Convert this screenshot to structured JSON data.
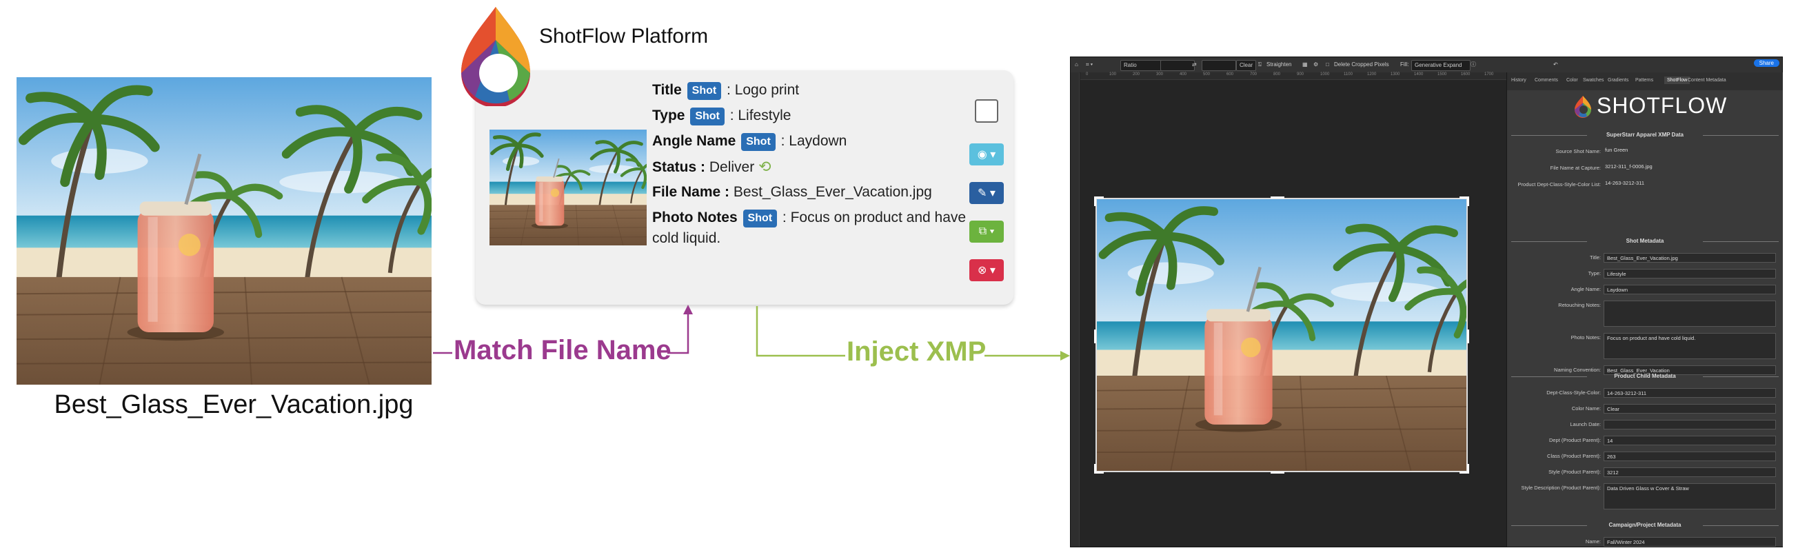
{
  "left_file_name": "Best_Glass_Ever_Vacation.jpg",
  "platform_title": "ShotFlow Platform",
  "shot_badge": "Shot",
  "card": {
    "title_label": "Title",
    "title_value": ": Logo print",
    "type_label": "Type",
    "type_value": ": Lifestyle",
    "angle_label": "Angle Name",
    "angle_value": ": Laydown",
    "status_label": "Status :",
    "status_value": "Deliver",
    "filename_label": "File Name :",
    "filename_value": "Best_Glass_Ever_Vacation.jpg",
    "notes_label": "Photo Notes",
    "notes_value": ": Focus on product and have cold liquid."
  },
  "arrows": {
    "match": "Match File Name",
    "inject": "Inject XMP"
  },
  "editor": {
    "toolbar": {
      "ratio": "Ratio",
      "clear": "Clear",
      "straighten": "Straighten",
      "delete_cropped": "Delete Cropped Pixels",
      "fill_label": "Fill:",
      "fill_value": "Generative Expand",
      "share": "Share"
    },
    "ruler_ticks": [
      "0",
      "100",
      "200",
      "300",
      "400",
      "500",
      "600",
      "700",
      "800",
      "900",
      "1000",
      "1100",
      "1200",
      "1300",
      "1400",
      "1500",
      "1600",
      "1700"
    ],
    "tabs": [
      "History",
      "Comments",
      "Color",
      "Swatches",
      "Gradients",
      "Patterns",
      "ShotFlow",
      "Content Metadata"
    ],
    "active_tab": "ShotFlow",
    "panel_logo": "SHOTFLOW",
    "sections": {
      "superstar": "SuperStarr Apparel XMP Data",
      "shot_meta": "Shot Metadata",
      "product_child": "Product Child Metadata",
      "campaign": "Campaign/Project Metadata"
    },
    "superstar_rows": [
      {
        "label": "Source Shot Name:",
        "value": "fun Green"
      },
      {
        "label": "File Name at Capture:",
        "value": "3212-311_f-0006.jpg"
      },
      {
        "label": "Product Dept-Class-Style-Color List:",
        "value": "14-263-3212-311"
      }
    ],
    "shot_rows": [
      {
        "label": "Title:",
        "value": "Best_Glass_Ever_Vacation.jpg"
      },
      {
        "label": "Type:",
        "value": "Lifestyle"
      },
      {
        "label": "Angle Name:",
        "value": "Laydown"
      },
      {
        "label": "Retouching Notes:",
        "value": ""
      },
      {
        "label": "Photo Notes:",
        "value": "Focus on product and have cold liquid."
      },
      {
        "label": "Naming Convention:",
        "value": "Best_Glass_Ever_Vacation"
      }
    ],
    "product_rows": [
      {
        "label": "Dept-Class-Style-Color:",
        "value": "14-263-3212-311"
      },
      {
        "label": "Color Name:",
        "value": "Clear"
      },
      {
        "label": "Launch Date:",
        "value": ""
      },
      {
        "label": "Dept (Product Parent):",
        "value": "14"
      },
      {
        "label": "Class (Product Parent):",
        "value": "263"
      },
      {
        "label": "Style (Product Parent):",
        "value": "3212"
      },
      {
        "label": "Style Description (Product Parent):",
        "value": "Data Driven Glass w Cover & Straw"
      }
    ],
    "campaign_rows": [
      {
        "label": "Name:",
        "value": "Fall/Winter 2024"
      }
    ]
  },
  "colors": {
    "match_arrow": "#9b3a8e",
    "inject_arrow": "#9cbf4e",
    "shot_badge": "#2a6eb5",
    "eye_button": "#5bc0de",
    "edit_button": "#2a5fa0",
    "copy_button": "#6cb33e",
    "delete_button": "#d9304a",
    "share_button": "#1a73e8"
  }
}
